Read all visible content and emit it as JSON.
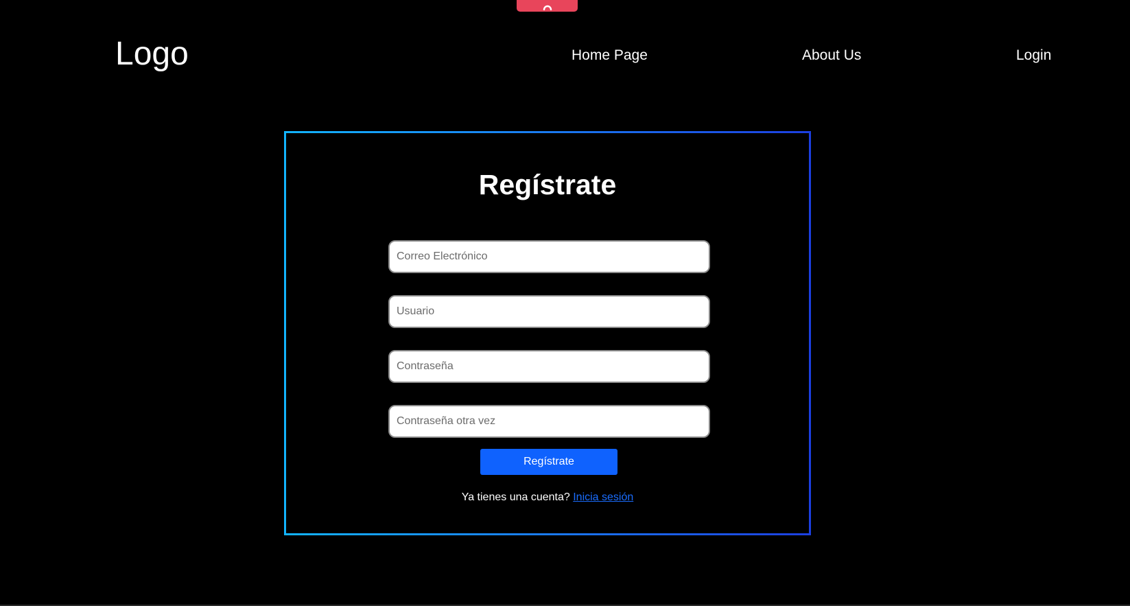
{
  "header": {
    "logo": "Logo",
    "nav": {
      "home": "Home Page",
      "about": "About Us",
      "login": "Login"
    }
  },
  "form": {
    "title": "Regístrate",
    "fields": {
      "email_placeholder": "Correo Electrónico",
      "user_placeholder": "Usuario",
      "password_placeholder": "Contraseña",
      "password_repeat_placeholder": "Contraseña otra vez"
    },
    "submit_label": "Regístrate",
    "footer_text": "Ya tienes una cuenta? ",
    "footer_link": "Inicia sesión"
  },
  "colors": {
    "background": "#000000",
    "accent_button": "#0f62fe",
    "link": "#1a6dff",
    "top_tab": "#e8455b",
    "border_gradient_start": "#12b4ff",
    "border_gradient_end": "#1c3fe0"
  },
  "icons": {
    "top_tab": "arc-icon"
  }
}
